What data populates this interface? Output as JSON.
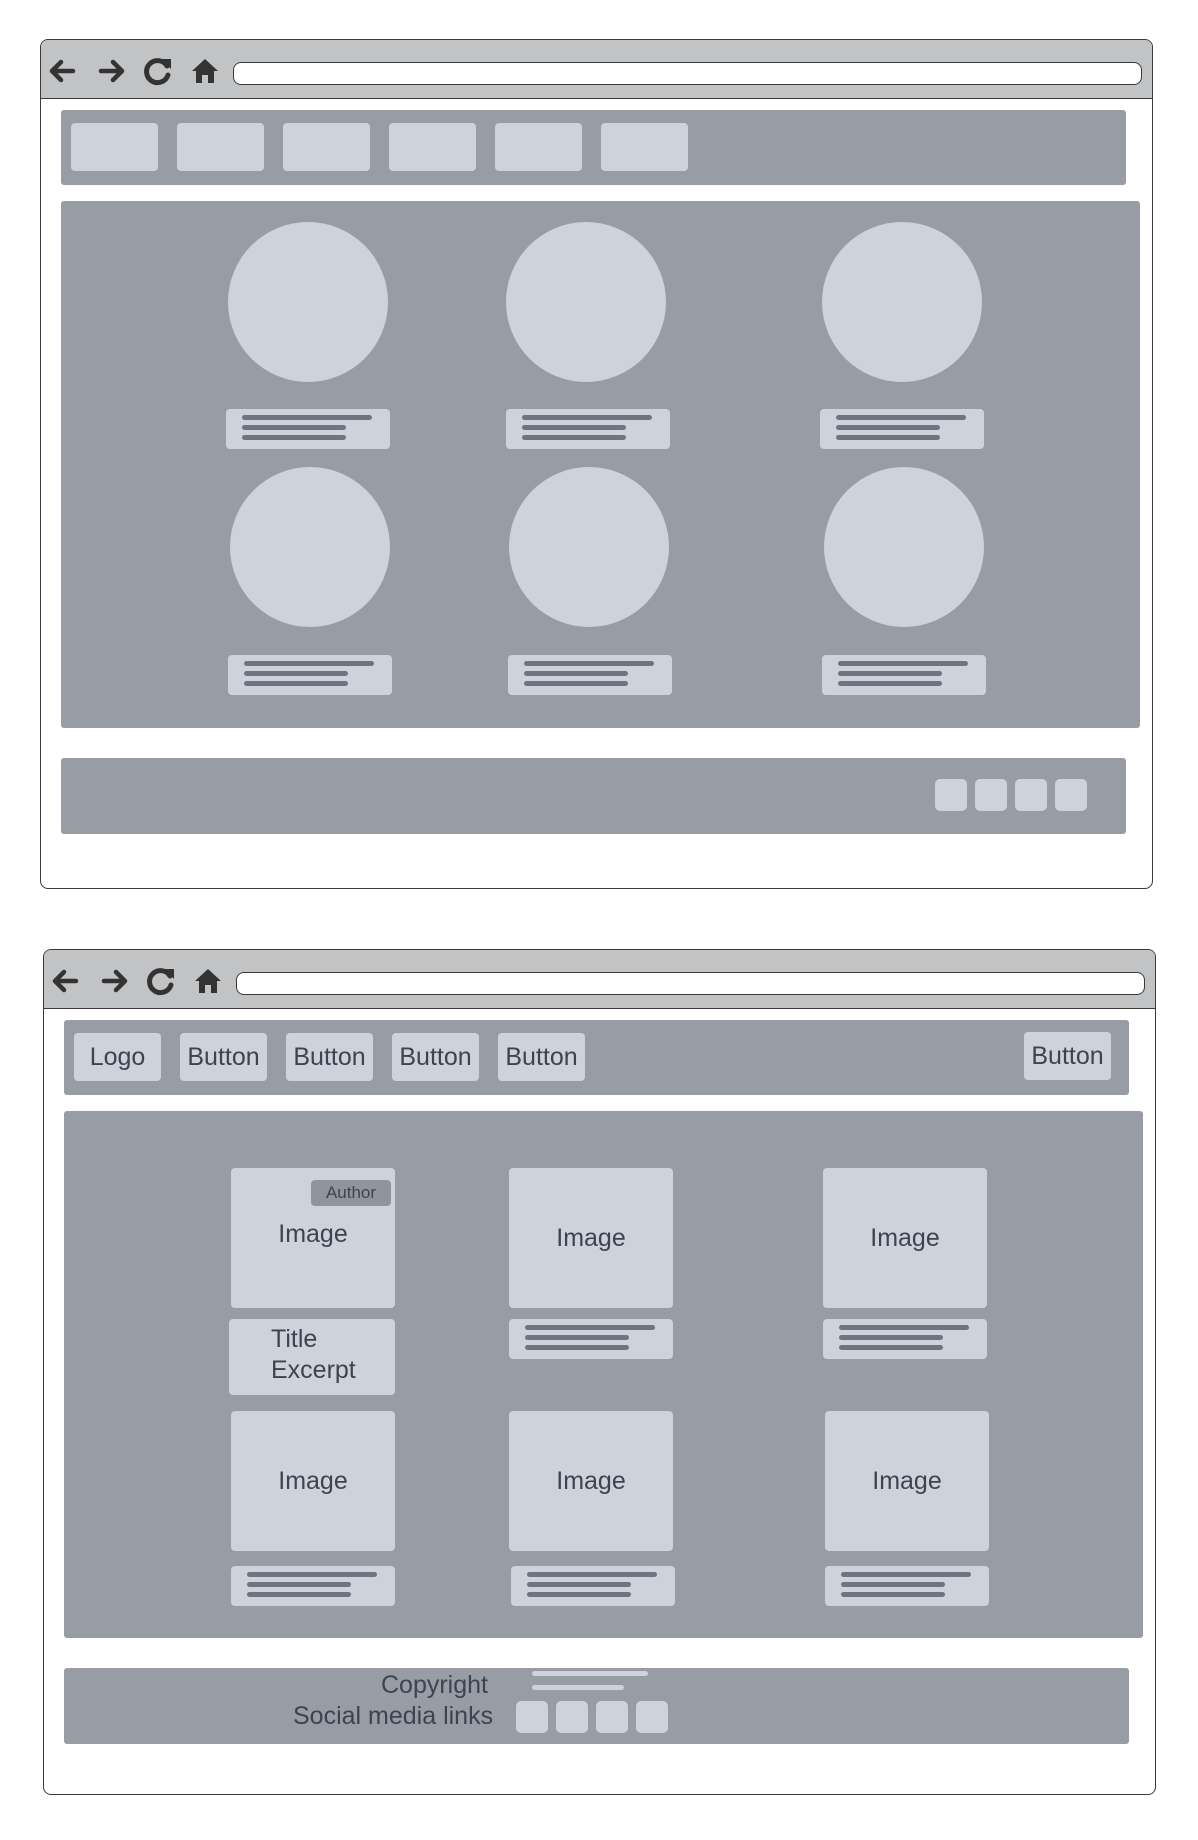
{
  "colors": {
    "band": "#979ca5",
    "chip": "#cdd2db",
    "text": "#3e4350",
    "frame": "#3a3a3a",
    "titlebar": "#c2c3c5"
  },
  "browser_controls": {
    "icons": [
      "back-arrow-icon",
      "forward-arrow-icon",
      "reload-icon",
      "home-icon"
    ]
  },
  "wireframe_low_fidelity": {
    "nav_placeholder_count": 6,
    "circle_cards": 6,
    "footer_square_count": 4
  },
  "wireframe_labeled": {
    "nav": {
      "logo": "Logo",
      "buttons": [
        "Button",
        "Button",
        "Button",
        "Button"
      ],
      "right_button": "Button"
    },
    "featured_card": {
      "author_badge": "Author",
      "image_label": "Image",
      "title": "Title",
      "excerpt": "Excerpt"
    },
    "cards": [
      {
        "image_label": "Image"
      },
      {
        "image_label": "Image"
      },
      {
        "image_label": "Image"
      },
      {
        "image_label": "Image"
      },
      {
        "image_label": "Image"
      }
    ],
    "footer": {
      "copyright": "Copyright",
      "social_label": "Social media links",
      "social_icon_count": 4
    }
  }
}
